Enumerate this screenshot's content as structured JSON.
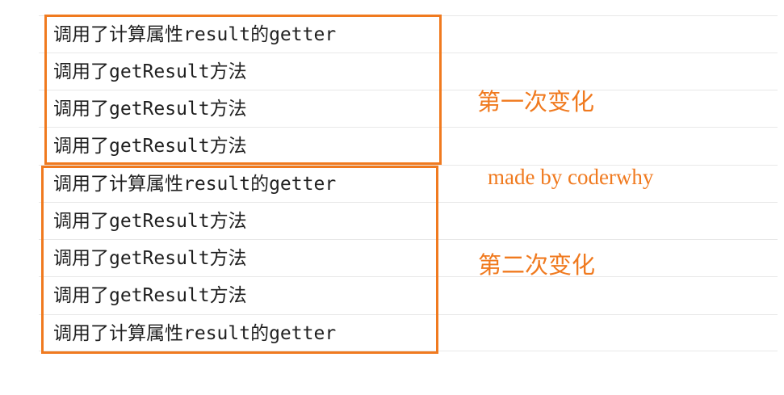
{
  "console": {
    "rows": [
      "调用了计算属性result的getter",
      "调用了getResult方法",
      "调用了getResult方法",
      "调用了getResult方法",
      "调用了计算属性result的getter",
      "调用了getResult方法",
      "调用了getResult方法",
      "调用了getResult方法",
      "调用了计算属性result的getter"
    ]
  },
  "annotations": {
    "first_change": "第一次变化",
    "credit": "made by coderwhy",
    "second_change": "第二次变化"
  },
  "colors": {
    "highlight": "#f07a1f",
    "row_divider": "#e8e8e8",
    "text": "#1f1f1f"
  }
}
